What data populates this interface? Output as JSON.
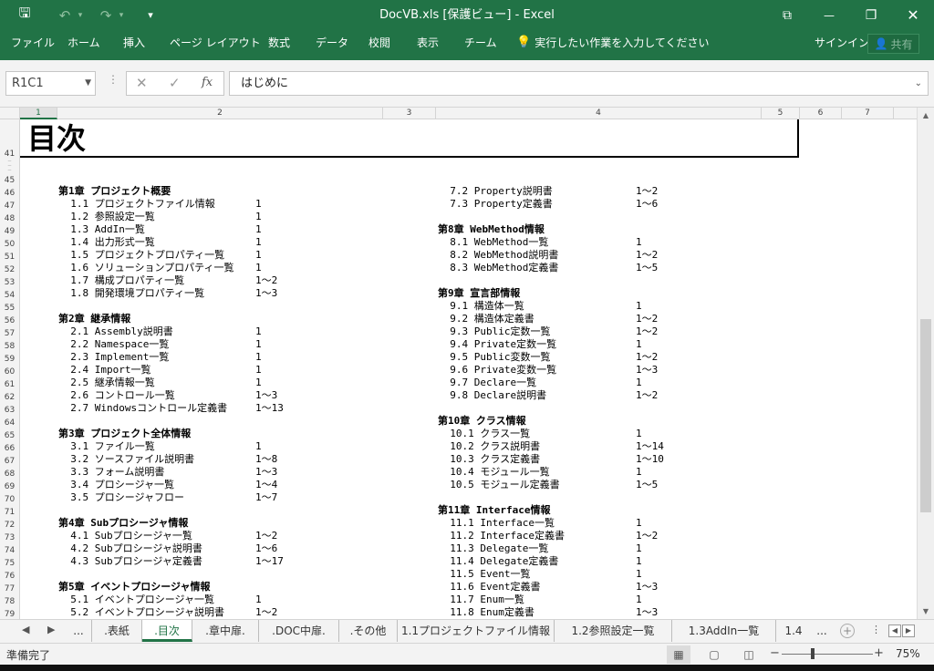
{
  "window": {
    "title": "DocVB.xls  [保護ビュー] - Excel",
    "undo_glyph": "↶",
    "redo_glyph": "↷",
    "save_glyph": "🖫",
    "customize_glyph": "▾",
    "ribbon_display_glyph": "⧉",
    "minimize_glyph": "—",
    "restore_glyph": "❐",
    "close_glyph": "✕"
  },
  "ribbon": {
    "tabs": [
      "ファイル",
      "ホーム",
      "挿入",
      "ページ レイアウト",
      "数式",
      "データ",
      "校閲",
      "表示",
      "チーム"
    ],
    "tell_me": "実行したい作業を入力してください",
    "sign_in": "サインイン",
    "share": "共有"
  },
  "formula_bar": {
    "name_box": "R1C1",
    "cancel_glyph": "✕",
    "enter_glyph": "✓",
    "fx_glyph": "fx",
    "value": "はじめに"
  },
  "columns": [
    "1",
    "2",
    "3",
    "4",
    "5",
    "6",
    "7"
  ],
  "rows": [
    "41",
    "45",
    "46",
    "47",
    "48",
    "49",
    "50",
    "51",
    "52",
    "53",
    "54",
    "55",
    "56",
    "57",
    "58",
    "59",
    "60",
    "61",
    "62",
    "63",
    "64",
    "65",
    "66",
    "67",
    "68",
    "69",
    "70",
    "71",
    "72",
    "73",
    "74",
    "75",
    "76",
    "77",
    "78",
    "79"
  ],
  "sheet": {
    "heading": "目次",
    "toc_left": [
      {
        "text": "第1章 プロジェクト概要",
        "page": "",
        "chapter": true
      },
      {
        "text": "  1.1 プロジェクトファイル情報",
        "page": "1"
      },
      {
        "text": "  1.2 参照設定一覧",
        "page": "1"
      },
      {
        "text": "  1.3 AddIn一覧",
        "page": "1"
      },
      {
        "text": "  1.4 出力形式一覧",
        "page": "1"
      },
      {
        "text": "  1.5 プロジェクトプロパティ一覧",
        "page": "1"
      },
      {
        "text": "  1.6 ソリューションプロパティ一覧",
        "page": "1"
      },
      {
        "text": "  1.7 構成プロパティ一覧",
        "page": "1～2"
      },
      {
        "text": "  1.8 開発環境プロパティ一覧",
        "page": "1～3"
      },
      {
        "text": "",
        "page": ""
      },
      {
        "text": "第2章 継承情報",
        "page": "",
        "chapter": true
      },
      {
        "text": "  2.1 Assembly説明書",
        "page": "1"
      },
      {
        "text": "  2.2 Namespace一覧",
        "page": "1"
      },
      {
        "text": "  2.3 Implement一覧",
        "page": "1"
      },
      {
        "text": "  2.4 Import一覧",
        "page": "1"
      },
      {
        "text": "  2.5 継承情報一覧",
        "page": "1"
      },
      {
        "text": "  2.6 コントロール一覧",
        "page": "1～3"
      },
      {
        "text": "  2.7 Windowsコントロール定義書",
        "page": "1～13"
      },
      {
        "text": "",
        "page": ""
      },
      {
        "text": "第3章 プロジェクト全体情報",
        "page": "",
        "chapter": true
      },
      {
        "text": "  3.1 ファイル一覧",
        "page": "1"
      },
      {
        "text": "  3.2 ソースファイル説明書",
        "page": "1～8"
      },
      {
        "text": "  3.3 フォーム説明書",
        "page": "1～3"
      },
      {
        "text": "  3.4 プロシージャ一覧",
        "page": "1～4"
      },
      {
        "text": "  3.5 プロシージャフロー",
        "page": "1～7"
      },
      {
        "text": "",
        "page": ""
      },
      {
        "text": "第4章 Subプロシージャ情報",
        "page": "",
        "chapter": true
      },
      {
        "text": "  4.1 Subプロシージャ一覧",
        "page": "1～2"
      },
      {
        "text": "  4.2 Subプロシージャ説明書",
        "page": "1～6"
      },
      {
        "text": "  4.3 Subプロシージャ定義書",
        "page": "1～17"
      },
      {
        "text": "",
        "page": ""
      },
      {
        "text": "第5章 イベントプロシージャ情報",
        "page": "",
        "chapter": true
      },
      {
        "text": "  5.1 イベントプロシージャ一覧",
        "page": "1"
      },
      {
        "text": "  5.2 イベントプロシージャ説明書",
        "page": "1～2"
      }
    ],
    "toc_right": [
      {
        "text": "  7.2 Property説明書",
        "page": "1～2"
      },
      {
        "text": "  7.3 Property定義書",
        "page": "1～6"
      },
      {
        "text": "",
        "page": ""
      },
      {
        "text": "第8章 WebMethod情報",
        "page": "",
        "chapter": true
      },
      {
        "text": "  8.1 WebMethod一覧",
        "page": "1"
      },
      {
        "text": "  8.2 WebMethod説明書",
        "page": "1～2"
      },
      {
        "text": "  8.3 WebMethod定義書",
        "page": "1～5"
      },
      {
        "text": "",
        "page": ""
      },
      {
        "text": "第9章 宣言部情報",
        "page": "",
        "chapter": true
      },
      {
        "text": "  9.1 構造体一覧",
        "page": "1"
      },
      {
        "text": "  9.2 構造体定義書",
        "page": "1～2"
      },
      {
        "text": "  9.3 Public定数一覧",
        "page": "1～2"
      },
      {
        "text": "  9.4 Private定数一覧",
        "page": "1"
      },
      {
        "text": "  9.5 Public変数一覧",
        "page": "1～2"
      },
      {
        "text": "  9.6 Private変数一覧",
        "page": "1～3"
      },
      {
        "text": "  9.7 Declare一覧",
        "page": "1"
      },
      {
        "text": "  9.8 Declare説明書",
        "page": "1～2"
      },
      {
        "text": "",
        "page": ""
      },
      {
        "text": "第10章 クラス情報",
        "page": "",
        "chapter": true
      },
      {
        "text": "  10.1 クラス一覧",
        "page": "1"
      },
      {
        "text": "  10.2 クラス説明書",
        "page": "1～14"
      },
      {
        "text": "  10.3 クラス定義書",
        "page": "1～10"
      },
      {
        "text": "  10.4 モジュール一覧",
        "page": "1"
      },
      {
        "text": "  10.5 モジュール定義書",
        "page": "1～5"
      },
      {
        "text": "",
        "page": ""
      },
      {
        "text": "第11章 Interface情報",
        "page": "",
        "chapter": true
      },
      {
        "text": "  11.1 Interface一覧",
        "page": "1"
      },
      {
        "text": "  11.2 Interface定義書",
        "page": "1～2"
      },
      {
        "text": "  11.3 Delegate一覧",
        "page": "1"
      },
      {
        "text": "  11.4 Delegate定義書",
        "page": "1"
      },
      {
        "text": "  11.5 Event一覧",
        "page": "1"
      },
      {
        "text": "  11.6 Event定義書",
        "page": "1～3"
      },
      {
        "text": "  11.7 Enum一覧",
        "page": "1"
      },
      {
        "text": "  11.8 Enum定義書",
        "page": "1～3"
      }
    ]
  },
  "sheet_tabs": {
    "nav_prev": "◀",
    "nav_next": "▶",
    "ellipsis_left": "...",
    "tabs": [
      ".表紙",
      ".目次",
      ".章中扉.",
      ".DOC中扉.",
      ".その他",
      "1.1プロジェクトファイル情報",
      "1.2参照設定一覧",
      "1.3AddIn一覧",
      "1.4"
    ],
    "ellipsis_right": "...",
    "add": "+",
    "more": "⋮"
  },
  "status": {
    "ready": "準備完了",
    "zoom_out": "−",
    "zoom_in": "+",
    "zoom": "75%"
  }
}
